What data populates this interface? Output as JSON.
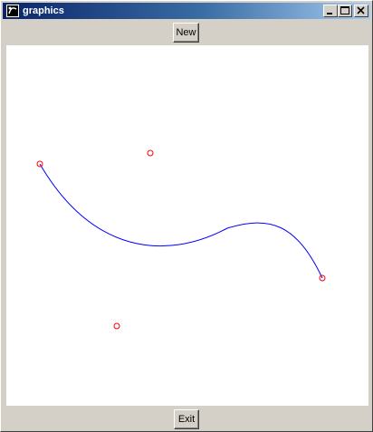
{
  "window": {
    "title": "graphics"
  },
  "toolbar": {
    "new_label": "New"
  },
  "footer": {
    "exit_label": "Exit"
  },
  "canvas": {
    "background": "#ffffff",
    "curve_color": "#0000ff",
    "point_color": "#ff0000",
    "curve_type": "cubic-bezier",
    "control_point_count": 4
  },
  "icons": {
    "app": "app-icon",
    "minimize": "minimize-icon",
    "maximize": "maximize-icon",
    "close": "close-icon"
  }
}
